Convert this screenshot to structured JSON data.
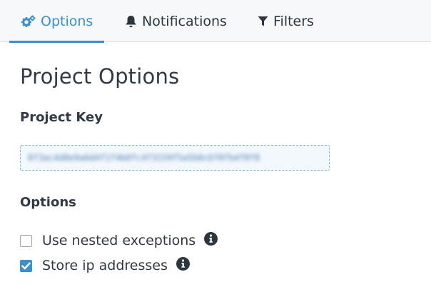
{
  "tabs": [
    {
      "label": "Options",
      "icon": "gears-icon",
      "active": true
    },
    {
      "label": "Notifications",
      "icon": "bell-icon",
      "active": false
    },
    {
      "label": "Filters",
      "icon": "filter-icon",
      "active": false
    }
  ],
  "page": {
    "title": "Project Options",
    "project_key_label": "Project Key",
    "project_key_value": "8f3ac4d8e9a6d4f1f4b0fc4f3159f5a5b0c6f0fb4f0f8",
    "options_label": "Options"
  },
  "options": [
    {
      "label": "Use nested exceptions",
      "checked": false,
      "info_icon": "info-icon"
    },
    {
      "label": "Store ip addresses",
      "checked": true,
      "info_icon": "info-icon"
    }
  ],
  "colors": {
    "accent": "#3a8fd0",
    "text": "#2f3a45",
    "tabbar_bg": "#f6f8f9"
  }
}
